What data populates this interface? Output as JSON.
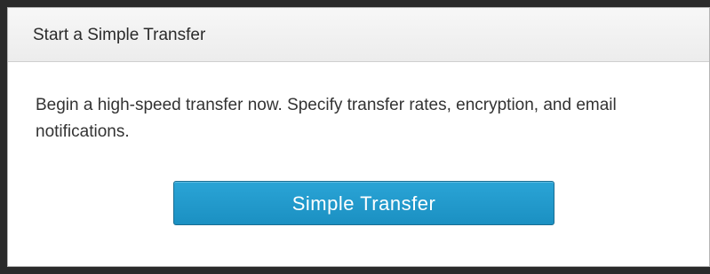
{
  "panel": {
    "title": "Start a Simple Transfer",
    "description": "Begin a high-speed transfer now. Specify transfer rates, encryption, and email notifications.",
    "button_label": "Simple Transfer"
  }
}
